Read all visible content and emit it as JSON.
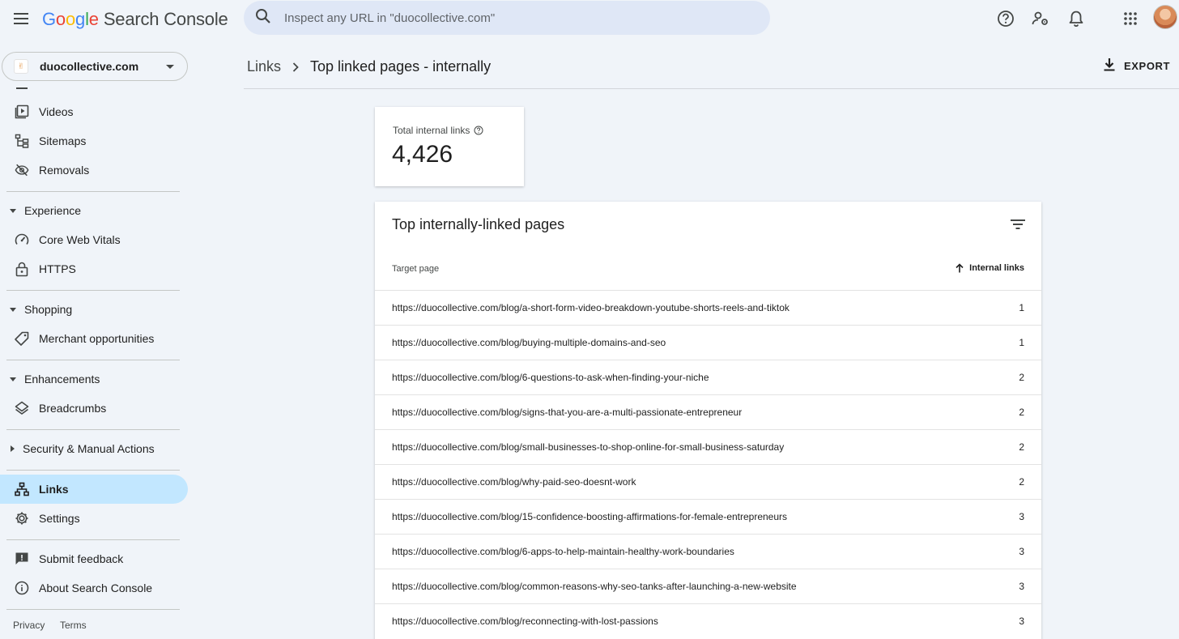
{
  "header": {
    "product": "Search Console",
    "search_placeholder": "Inspect any URL in \"duocollective.com\""
  },
  "property": {
    "name": "duocollective.com"
  },
  "sidebar": {
    "items_top": [
      {
        "label": "Videos",
        "icon": "video-pages-icon"
      },
      {
        "label": "Sitemaps",
        "icon": "sitemap-icon"
      },
      {
        "label": "Removals",
        "icon": "eye-off-icon"
      }
    ],
    "experience": {
      "label": "Experience",
      "items": [
        {
          "label": "Core Web Vitals",
          "icon": "speedometer-icon"
        },
        {
          "label": "HTTPS",
          "icon": "lock-icon"
        }
      ]
    },
    "shopping": {
      "label": "Shopping",
      "items": [
        {
          "label": "Merchant opportunities",
          "icon": "tag-icon"
        }
      ]
    },
    "enhancements": {
      "label": "Enhancements",
      "items": [
        {
          "label": "Breadcrumbs",
          "icon": "layers-icon"
        }
      ]
    },
    "security": {
      "label": "Security & Manual Actions"
    },
    "links": {
      "label": "Links"
    },
    "settings": {
      "label": "Settings"
    },
    "feedback": {
      "label": "Submit feedback"
    },
    "about": {
      "label": "About Search Console"
    },
    "footer": {
      "privacy": "Privacy",
      "terms": "Terms"
    }
  },
  "breadcrumb": {
    "parent": "Links",
    "current": "Top linked pages - internally"
  },
  "export_label": "EXPORT",
  "total": {
    "label": "Total internal links",
    "value": "4,426"
  },
  "table": {
    "title": "Top internally-linked pages",
    "col_target": "Target page",
    "col_links": "Internal links",
    "sort": "ascending",
    "rows": [
      {
        "url": "https://duocollective.com/blog/a-short-form-video-breakdown-youtube-shorts-reels-and-tiktok",
        "count": "1"
      },
      {
        "url": "https://duocollective.com/blog/buying-multiple-domains-and-seo",
        "count": "1"
      },
      {
        "url": "https://duocollective.com/blog/6-questions-to-ask-when-finding-your-niche",
        "count": "2"
      },
      {
        "url": "https://duocollective.com/blog/signs-that-you-are-a-multi-passionate-entrepreneur",
        "count": "2"
      },
      {
        "url": "https://duocollective.com/blog/small-businesses-to-shop-online-for-small-business-saturday",
        "count": "2"
      },
      {
        "url": "https://duocollective.com/blog/why-paid-seo-doesnt-work",
        "count": "2"
      },
      {
        "url": "https://duocollective.com/blog/15-confidence-boosting-affirmations-for-female-entrepreneurs",
        "count": "3"
      },
      {
        "url": "https://duocollective.com/blog/6-apps-to-help-maintain-healthy-work-boundaries",
        "count": "3"
      },
      {
        "url": "https://duocollective.com/blog/common-reasons-why-seo-tanks-after-launching-a-new-website",
        "count": "3"
      },
      {
        "url": "https://duocollective.com/blog/reconnecting-with-lost-passions",
        "count": "3"
      }
    ]
  },
  "colors": {
    "active_nav": "#c2e7ff",
    "background": "#f0f4f9",
    "search_bg": "#dfe7f6"
  }
}
